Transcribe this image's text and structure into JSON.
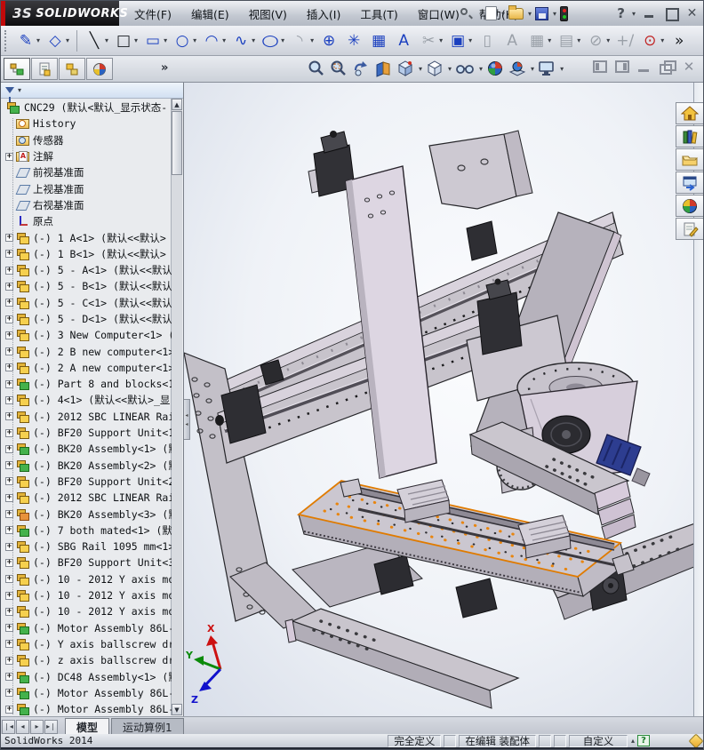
{
  "window": {
    "logo_mark": "3S",
    "logo_brand": "SOLIDWORKS"
  },
  "menu": {
    "items": [
      "文件(F)",
      "编辑(E)",
      "视图(V)",
      "插入(I)",
      "工具(T)",
      "窗口(W)",
      "帮助(H)"
    ]
  },
  "sketch_toolbar": {
    "items": [
      {
        "n": "sketch",
        "g": "✎",
        "c": "b",
        "dd": 1
      },
      {
        "n": "smart-dimension",
        "g": "◇",
        "c": "b",
        "dd": 1,
        "sepAfter": 1
      },
      {
        "n": "line",
        "g": "╲",
        "c": "k",
        "dd": 1
      },
      {
        "n": "corner-rectangle",
        "g": "□",
        "c": "k",
        "dd": 1
      },
      {
        "n": "straight-slot",
        "g": "▭",
        "c": "b",
        "dd": 1
      },
      {
        "n": "circle",
        "g": "○",
        "c": "b",
        "dd": 1
      },
      {
        "n": "centerpoint-arc",
        "g": "◠",
        "c": "b",
        "dd": 1
      },
      {
        "n": "spline",
        "g": "∿",
        "c": "b",
        "dd": 1
      },
      {
        "n": "ellipse",
        "g": "○",
        "c": "b",
        "dd": 1
      },
      {
        "n": "sketch-fillet",
        "g": "◝",
        "c": "g",
        "dd": 1
      },
      {
        "n": "point",
        "g": "⊕",
        "c": "b"
      },
      {
        "n": "star",
        "g": "✳",
        "c": "b"
      },
      {
        "n": "surface-mesh",
        "g": "▦",
        "c": "b"
      },
      {
        "n": "text",
        "g": "A",
        "c": "b"
      },
      {
        "n": "trim-entities",
        "g": "✂",
        "c": "g",
        "dd": 1
      },
      {
        "n": "convert-entities",
        "g": "▣",
        "c": "b",
        "dd": 1
      },
      {
        "n": "mirror-entities",
        "g": "▯",
        "c": "g"
      },
      {
        "n": "annotation",
        "g": "A",
        "c": "g"
      },
      {
        "n": "linear-pattern",
        "g": "▦",
        "c": "g",
        "dd": 1
      },
      {
        "n": "circular-pattern",
        "g": "▤",
        "c": "g",
        "dd": 1
      },
      {
        "n": "move-entities",
        "g": "⊘",
        "c": "g",
        "dd": 1
      },
      {
        "n": "sketch-picture",
        "g": "+/",
        "c": "g"
      },
      {
        "n": "reference-axis",
        "g": "⊙",
        "c": "r",
        "dd": 1
      },
      {
        "n": "toolbar-overflow",
        "g": "»",
        "c": "k"
      }
    ]
  },
  "panel": {
    "overflow": "»"
  },
  "tree": {
    "root": "CNC29  (默认<默认_显示状态-",
    "items": [
      {
        "t": "history",
        "l": "History"
      },
      {
        "t": "sensors",
        "l": "传感器"
      },
      {
        "t": "annotations",
        "l": "注解",
        "e": 1
      },
      {
        "t": "plane",
        "l": "前视基准面"
      },
      {
        "t": "plane",
        "l": "上视基准面"
      },
      {
        "t": "plane",
        "l": "右视基准面"
      },
      {
        "t": "origin",
        "l": "原点"
      },
      {
        "t": "asm",
        "l": "(-) 1 A<1> (默认<<默认>",
        "e": 1
      },
      {
        "t": "asm",
        "l": "(-) 1 B<1> (默认<<默认>",
        "e": 1
      },
      {
        "t": "asm",
        "l": "(-) 5 - A<1> (默认<<默认",
        "e": 1
      },
      {
        "t": "asm",
        "l": "(-) 5 - B<1> (默认<<默认",
        "e": 1
      },
      {
        "t": "asm",
        "l": "(-) 5 - C<1> (默认<<默认",
        "e": 1
      },
      {
        "t": "asm",
        "l": "(-) 5 - D<1> (默认<<默认",
        "e": 1
      },
      {
        "t": "asm",
        "l": "(-) 3 New Computer<1> (",
        "e": 1
      },
      {
        "t": "asm",
        "l": "(-) 2 B new computer<1>",
        "e": 1
      },
      {
        "t": "asm",
        "l": "(-) 2 A new computer<1>",
        "e": 1
      },
      {
        "t": "asm-green",
        "l": "(-) Part 8 and blocks<1",
        "e": 1
      },
      {
        "t": "asm",
        "l": "(-) 4<1> (默认<<默认>_显",
        "e": 1
      },
      {
        "t": "asm",
        "l": "(-) 2012 SBC LINEAR Rai",
        "e": 1
      },
      {
        "t": "asm",
        "l": "(-) BF20 Support Unit<1",
        "e": 1
      },
      {
        "t": "asm-green",
        "l": "(-) BK20 Assembly<1> (默",
        "e": 1
      },
      {
        "t": "asm-green",
        "l": "(-) BK20 Assembly<2> (默",
        "e": 1
      },
      {
        "t": "asm",
        "l": "(-) BF20 Support Unit<2",
        "e": 1
      },
      {
        "t": "asm",
        "l": "(-) 2012 SBC LINEAR Rai",
        "e": 1
      },
      {
        "t": "asm-orange",
        "l": "(-) BK20 Assembly<3> (默",
        "e": 1
      },
      {
        "t": "asm-green",
        "l": "(-) 7 both mated<1> (默",
        "e": 1
      },
      {
        "t": "asm",
        "l": "(-) SBG Rail 1095 mm<1>",
        "e": 1
      },
      {
        "t": "asm",
        "l": "(-) BF20 Support Unit<3",
        "e": 1
      },
      {
        "t": "asm",
        "l": "(-) 10 - 2012 Y axis mo",
        "e": 1
      },
      {
        "t": "asm",
        "l": "(-) 10 - 2012 Y axis mo",
        "e": 1
      },
      {
        "t": "asm",
        "l": "(-) 10 - 2012 Y axis mo",
        "e": 1
      },
      {
        "t": "asm-green",
        "l": "(-) Motor Assembly 86L-",
        "e": 1
      },
      {
        "t": "asm",
        "l": "(-) Y axis ballscrew dr",
        "e": 1
      },
      {
        "t": "asm",
        "l": "(-) z axis ballscrew dr",
        "e": 1
      },
      {
        "t": "asm-green",
        "l": "(-) DC48 Assembly<1> (默",
        "e": 1
      },
      {
        "t": "asm-green",
        "l": "(-) Motor Assembly 86L-",
        "e": 1
      },
      {
        "t": "asm-green",
        "l": "(-) Motor Assembly 86L-",
        "e": 1
      },
      {
        "t": "asm-orange",
        "l": "",
        "e": 1
      }
    ]
  },
  "viewport": {
    "triad": {
      "x": "X",
      "y": "Y",
      "z": "Z"
    },
    "selection_color": "#e07b00"
  },
  "doc_tabs": {
    "tabs": [
      {
        "label": "模型",
        "active": true
      },
      {
        "label": "运动算例1",
        "active": false
      }
    ]
  },
  "status": {
    "app": "SolidWorks 2014",
    "defined": "完全定义",
    "editing": "在编辑 装配体",
    "custom": "自定义"
  }
}
